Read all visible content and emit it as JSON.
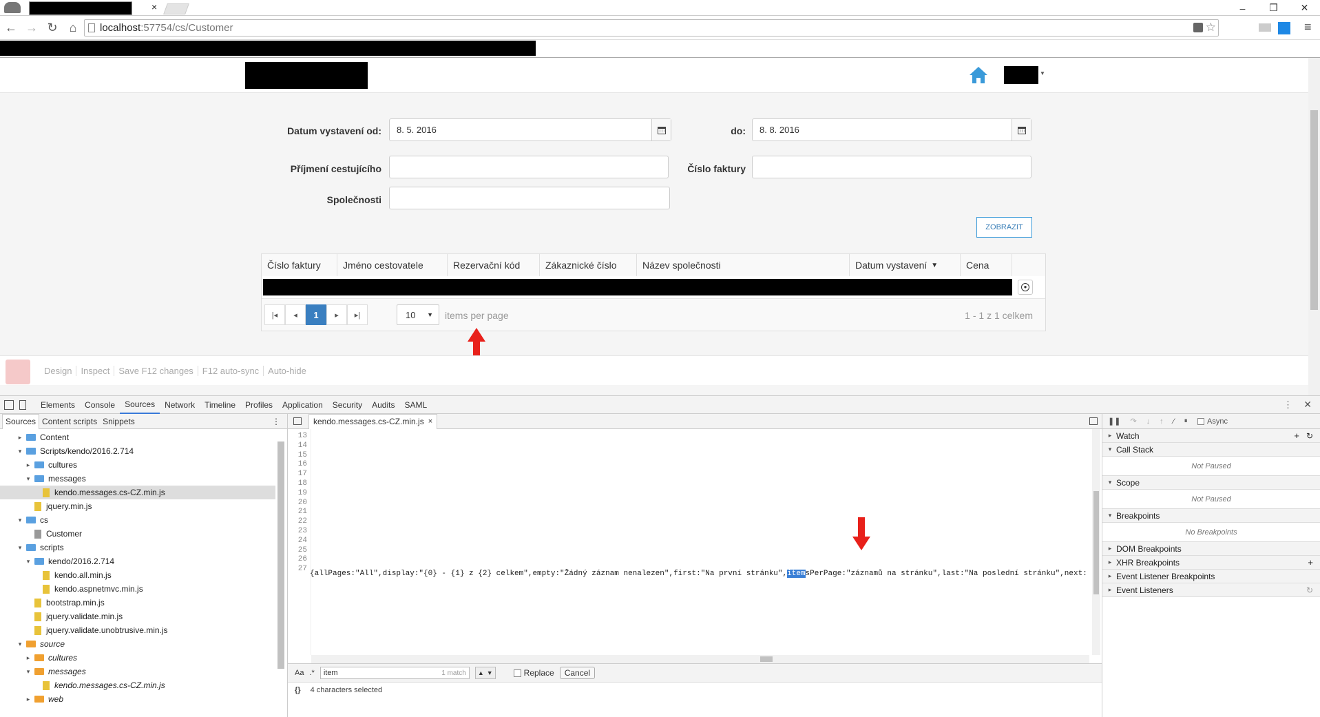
{
  "browser": {
    "url_host": "localhost",
    "url_rest": ":57754/cs/Customer"
  },
  "form": {
    "date_from_label": "Datum vystavení od:",
    "date_from_value": "8. 5. 2016",
    "date_to_label": "do:",
    "date_to_value": "8. 8. 2016",
    "surname_label": "Příjmení cestujícího",
    "invoice_label": "Číslo faktury",
    "company_label": "Společnosti",
    "show_button": "ZOBRAZIT"
  },
  "grid": {
    "columns": [
      "Číslo faktury",
      "Jméno cestovatele",
      "Rezervační kód",
      "Zákaznické číslo",
      "Název společnosti",
      "Datum vystavení",
      "Cena"
    ],
    "sort_indicator": "▼",
    "pager": {
      "current_page": "1",
      "page_size": "10",
      "items_per_page_text": "items per page",
      "summary": "1 - 1 z 1 celkem"
    }
  },
  "vs_toolbar": {
    "items": [
      "Design",
      "Inspect",
      "Save F12 changes",
      "F12 auto-sync",
      "Auto-hide"
    ]
  },
  "devtools": {
    "tabs": [
      "Elements",
      "Console",
      "Sources",
      "Network",
      "Timeline",
      "Profiles",
      "Application",
      "Security",
      "Audits",
      "SAML"
    ],
    "nav_tabs": [
      "Sources",
      "Content scripts",
      "Snippets"
    ],
    "tree": [
      {
        "label": "Content",
        "kind": "folder"
      },
      {
        "label": "Scripts/kendo/2016.2.714",
        "kind": "folder"
      },
      {
        "label": "cultures",
        "kind": "folder"
      },
      {
        "label": "messages",
        "kind": "folder"
      },
      {
        "label": "kendo.messages.cs-CZ.min.js",
        "kind": "file"
      },
      {
        "label": "jquery.min.js",
        "kind": "file"
      },
      {
        "label": "cs",
        "kind": "folder"
      },
      {
        "label": "Customer",
        "kind": "file"
      },
      {
        "label": "scripts",
        "kind": "folder"
      },
      {
        "label": "kendo/2016.2.714",
        "kind": "folder"
      },
      {
        "label": "kendo.all.min.js",
        "kind": "file"
      },
      {
        "label": "kendo.aspnetmvc.min.js",
        "kind": "file"
      },
      {
        "label": "bootstrap.min.js",
        "kind": "file"
      },
      {
        "label": "jquery.validate.min.js",
        "kind": "file"
      },
      {
        "label": "jquery.validate.unobtrusive.min.js",
        "kind": "file"
      },
      {
        "label": "source",
        "kind": "folder"
      },
      {
        "label": "cultures",
        "kind": "folder"
      },
      {
        "label": "messages",
        "kind": "folder"
      },
      {
        "label": "kendo.messages.cs-CZ.min.js",
        "kind": "file"
      },
      {
        "label": "web",
        "kind": "folder"
      }
    ],
    "editor_tab": "kendo.messages.cs-CZ.min.js",
    "line_numbers": [
      "13",
      "14",
      "15",
      "16",
      "17",
      "18",
      "19",
      "20",
      "21",
      "22",
      "23",
      "24",
      "25",
      "26",
      "27"
    ],
    "code_line_pre": "{allPages:\"All\",display:\"{0} - {1} z {2} celkem\",empty:\"Žádný záznam nenalezen\",first:\"Na první stránku\",",
    "code_line_match": "item",
    "code_line_post": "sPerPage:\"záznamů na stránku\",last:\"Na poslední stránku\",next:\"",
    "search_value": "item",
    "search_count": "1 match",
    "replace_label": "Replace",
    "cancel_label": "Cancel",
    "status": "4 characters selected",
    "debugger": {
      "async_label": "Async",
      "sections": [
        {
          "title": "Watch",
          "body": ""
        },
        {
          "title": "Call Stack",
          "body": "Not Paused"
        },
        {
          "title": "Scope",
          "body": "Not Paused"
        },
        {
          "title": "Breakpoints",
          "body": "No Breakpoints"
        },
        {
          "title": "DOM Breakpoints",
          "body": ""
        },
        {
          "title": "XHR Breakpoints",
          "body": ""
        },
        {
          "title": "Event Listener Breakpoints",
          "body": ""
        },
        {
          "title": "Event Listeners",
          "body": ""
        }
      ]
    }
  },
  "colors": {
    "accent": "#337ab7",
    "arrow": "#e8201a",
    "highlight": "#3a7fd6"
  }
}
